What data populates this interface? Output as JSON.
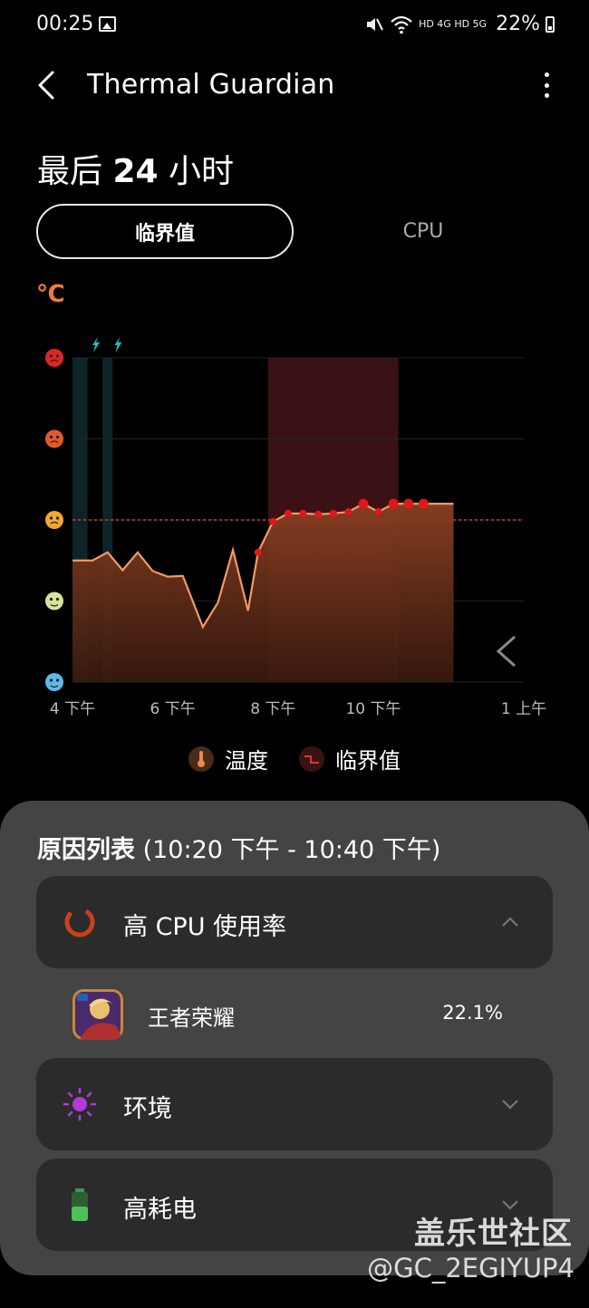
{
  "status_bar": {
    "time": "00:25",
    "network": "HD 4G HD 5G",
    "battery": "22%"
  },
  "app_bar": {
    "title": "Thermal Guardian"
  },
  "period": {
    "prefix": "最后",
    "value": "24",
    "suffix": "小时"
  },
  "tabs": [
    {
      "label": "临界值",
      "active": true
    },
    {
      "label": "CPU",
      "active": false
    }
  ],
  "unit": "℃",
  "chart_data": {
    "type": "area",
    "x_tick_labels": [
      "4 下午",
      "6 下午",
      "8 下午",
      "10 下午",
      "1 上午"
    ],
    "x_tick_hours": [
      16,
      18,
      20,
      22,
      25
    ],
    "y_levels": [
      "very-hot",
      "hot",
      "warm",
      "normal",
      "cool"
    ],
    "threshold_level": 2,
    "series": [
      {
        "name": "温度",
        "color": "#f29a66",
        "x": [
          16.0,
          16.4,
          16.7,
          17.0,
          17.3,
          17.6,
          17.9,
          18.2,
          18.6,
          18.9,
          19.2,
          19.5,
          19.7,
          20.0,
          20.3,
          20.6,
          20.9,
          21.2,
          21.5,
          21.8,
          22.1,
          22.4,
          22.7,
          23.0,
          23.6
        ],
        "y": [
          1.5,
          1.5,
          1.6,
          1.38,
          1.6,
          1.37,
          1.3,
          1.31,
          0.68,
          0.98,
          1.63,
          0.88,
          1.6,
          1.98,
          2.08,
          2.08,
          2.07,
          2.08,
          2.1,
          2.2,
          2.1,
          2.2,
          2.2,
          2.2,
          2.2
        ],
        "marker_from_index": 12
      }
    ],
    "critical_ranges": [
      {
        "start": 19.9,
        "end": 22.5,
        "color": "#3a1215"
      }
    ],
    "charging_ranges": [
      {
        "start": 16.0,
        "end": 16.3
      },
      {
        "start": 16.6,
        "end": 16.8
      }
    ]
  },
  "legend": [
    {
      "label": "温度",
      "color": "#e88a52"
    },
    {
      "label": "临界值",
      "color": "#d43a3a"
    }
  ],
  "reasons": {
    "title_main": "原因列表",
    "title_range": "(10:20 下午 - 10:40 下午)",
    "cards": [
      {
        "label": "高 CPU 使用率",
        "icon": "cpu-usage-ring-icon",
        "expanded": true
      },
      {
        "label": "环境",
        "icon": "sun-icon",
        "expanded": false
      },
      {
        "label": "高耗电",
        "icon": "battery-icon",
        "expanded": false
      }
    ],
    "apps": [
      {
        "name": "王者荣耀",
        "value": "22.1%",
        "icon": "game-app-icon"
      }
    ]
  },
  "watermark": {
    "line1": "盖乐世社区",
    "line2": "@GC_2EGIYUP4"
  }
}
